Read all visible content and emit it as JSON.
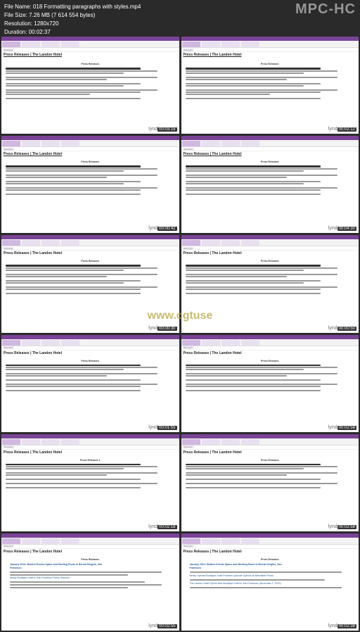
{
  "header": {
    "file_name_label": "File Name:",
    "file_name": "018 Formatting paragraphs with styles.mp4",
    "file_size_label": "File Size:",
    "file_size": "7.26 MB (7 614 554 bytes)",
    "resolution_label": "Resolution:",
    "resolution": "1280x720",
    "duration_label": "Duration:",
    "duration": "00:02:37",
    "player_logo": "MPC-HC"
  },
  "url_watermark": "www.cgtuse",
  "breadcrumb": "Business",
  "page": {
    "title": "Press Releases | The Landon Hotel",
    "title_short": "Press Releases",
    "heading": "Press Releases",
    "press_heading": "Press Releases 1"
  },
  "link_lines": {
    "l1": "January 2014: Modern Events Space and Meeting Room in Bernal Heights, San",
    "l2": "Francisco",
    "l3": "Newly renovated conference room available at The Landon Hotel San Francisco for meetings seating 50,",
    "l4": "Newly Boutique Hotel in San Francisco Earns Glamour",
    "l5": "Newly Opened Boutique Hotel Provides Upscale Options at Affordable Prices",
    "l6": "The Landon Hotel Opens New Boutique Hotel in San Francisco (November 1, 2013)"
  },
  "thumbnails": [
    {
      "timestamp": "00:03:18"
    },
    {
      "timestamp": "00:02:12"
    },
    {
      "timestamp": "00:00:42"
    },
    {
      "timestamp": "00:04:30"
    },
    {
      "timestamp": "00:00:30"
    },
    {
      "timestamp": "00:00:50"
    },
    {
      "timestamp": "00:01:55"
    },
    {
      "timestamp": "00:02:58"
    },
    {
      "timestamp": "00:02:18"
    },
    {
      "timestamp": "00:02:58"
    },
    {
      "timestamp": "00:02:55"
    },
    {
      "timestamp": "00:02:38"
    }
  ],
  "watermark_brand": "lynd"
}
